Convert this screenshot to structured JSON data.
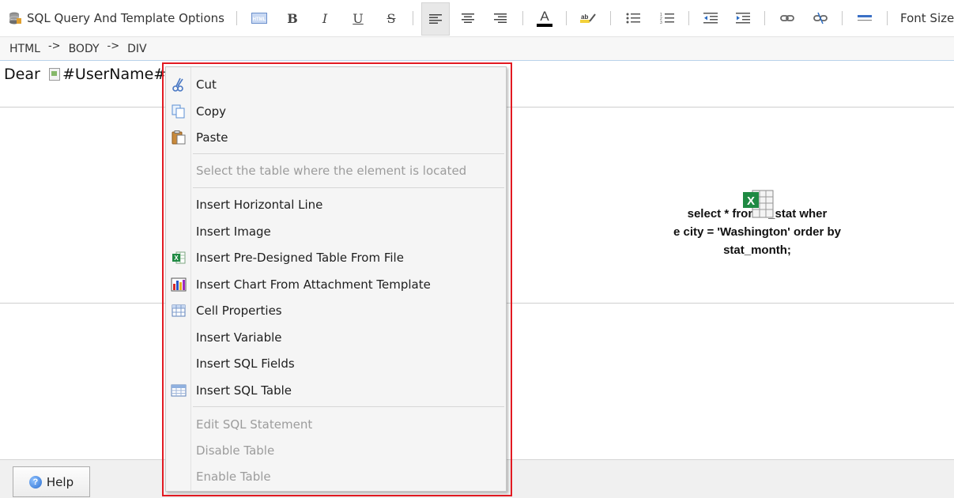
{
  "toolbar": {
    "title": "SQL Query And Template Options",
    "buttons": [
      "html-icon",
      "bold",
      "italic",
      "underline",
      "strikethrough",
      "align-left",
      "align-center",
      "align-right",
      "font-color",
      "spell-check",
      "bullet-list",
      "number-list",
      "outdent",
      "indent",
      "link",
      "unlink",
      "horizontal-rule"
    ],
    "bold_glyph": "B",
    "italic_glyph": "I",
    "underline_glyph": "U",
    "strike_glyph": "S",
    "font_color_glyph": "A",
    "font_size_label": "Font Size"
  },
  "breadcrumb": {
    "items": [
      "HTML",
      "BODY",
      "DIV"
    ],
    "separator": "->"
  },
  "editor": {
    "greeting": "Dear",
    "user_var": "#UserName#",
    "sql_lines": [
      "select * from     s_stat  wher",
      "e city = 'Washington' order by",
      "stat_month;"
    ]
  },
  "context_menu": {
    "items": [
      {
        "label": "Cut",
        "icon": "scissors-icon",
        "enabled": true
      },
      {
        "label": "Copy",
        "icon": "copy-icon",
        "enabled": true
      },
      {
        "label": "Paste",
        "icon": "paste-icon",
        "enabled": true
      },
      {
        "label": "Select the table where the element is located",
        "icon": "",
        "enabled": false
      },
      {
        "label": "Insert Horizontal Line",
        "icon": "",
        "enabled": true
      },
      {
        "label": "Insert Image",
        "icon": "",
        "enabled": true
      },
      {
        "label": "Insert Pre-Designed Table From File",
        "icon": "excel-icon",
        "enabled": true
      },
      {
        "label": "Insert Chart From Attachment Template",
        "icon": "chart-icon",
        "enabled": true
      },
      {
        "label": "Cell Properties",
        "icon": "table-grid-icon",
        "enabled": true
      },
      {
        "label": "Insert Variable",
        "icon": "",
        "enabled": true
      },
      {
        "label": "Insert SQL Fields",
        "icon": "",
        "enabled": true
      },
      {
        "label": "Insert SQL Table",
        "icon": "sql-table-icon",
        "enabled": true
      },
      {
        "label": "Edit SQL Statement",
        "icon": "",
        "enabled": false
      },
      {
        "label": "Disable Table",
        "icon": "",
        "enabled": false
      },
      {
        "label": "Enable Table",
        "icon": "",
        "enabled": false
      }
    ]
  },
  "footer": {
    "help_label": "Help"
  },
  "colors": {
    "highlight_outline": "#e21a22",
    "menu_bg": "#f5f5f5",
    "disabled_text": "#9c9c9c"
  }
}
